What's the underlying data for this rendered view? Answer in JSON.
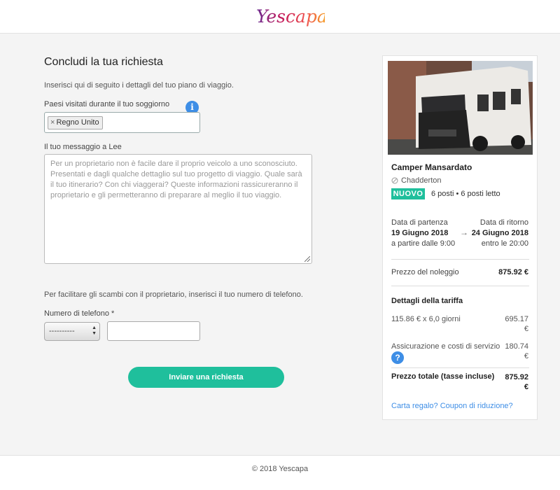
{
  "header": {
    "logo_text": "Yescapa"
  },
  "form": {
    "title": "Concludi la tua richiesta",
    "intro": "Inserisci qui di seguito i dettagli del tuo piano di viaggio.",
    "countries_label": "Paesi visitati durante il tuo soggiorno",
    "country_tag": "Regno Unito",
    "message_label": "Il tuo messaggio a Lee",
    "message_placeholder": "Per un proprietario non è facile dare il proprio veicolo a uno sconosciuto. Presentati e dagli qualche dettaglio sul tuo progetto di viaggio. Quale sarà il tuo itinerario? Con chi viaggerai? Queste informazioni rassicureranno il proprietario e gli permetteranno di preparare al meglio il tuo viaggio.",
    "phone_note": "Per facilitare gli scambi con il proprietario, inserisci il tuo numero di telefono.",
    "phone_label": "Numero di telefono *",
    "country_code_value": "----------",
    "phone_value": "",
    "submit_label": "Inviare una richiesta"
  },
  "booking": {
    "camper_name": "Camper Mansardato",
    "location": "Chadderton",
    "badge": "NUOVO",
    "capacity": "6 posti • 6 posti letto",
    "departure": {
      "label": "Data di partenza",
      "date": "19 Giugno 2018",
      "time": "a partire dalle 9:00"
    },
    "return": {
      "label": "Data di ritorno",
      "date": "24 Giugno 2018",
      "time": "entro le 20:00"
    },
    "rental_label": "Prezzo del noleggio",
    "rental_price": "875.92 €",
    "fare_title": "Dettagli della tariffa",
    "fare_rows": [
      {
        "label": "115.86 € x 6,0 giorni",
        "value": "695.17 €"
      },
      {
        "label": "Assicurazione e costi di servizio",
        "value": "180.74 €"
      }
    ],
    "total_label": "Prezzo totale (tasse incluse)",
    "total_value": "875.92 €",
    "coupon_link": "Carta regalo? Coupon di riduzione?"
  },
  "footer": {
    "copyright": "© 2018 Yescapa"
  },
  "colors": {
    "accent": "#1fbf9c",
    "link": "#3e8ee6",
    "background": "#f4f4f4"
  },
  "icons": {
    "info": "info-icon",
    "question": "question-icon",
    "location": "location-icon",
    "arrow": "arrow-right-icon"
  }
}
